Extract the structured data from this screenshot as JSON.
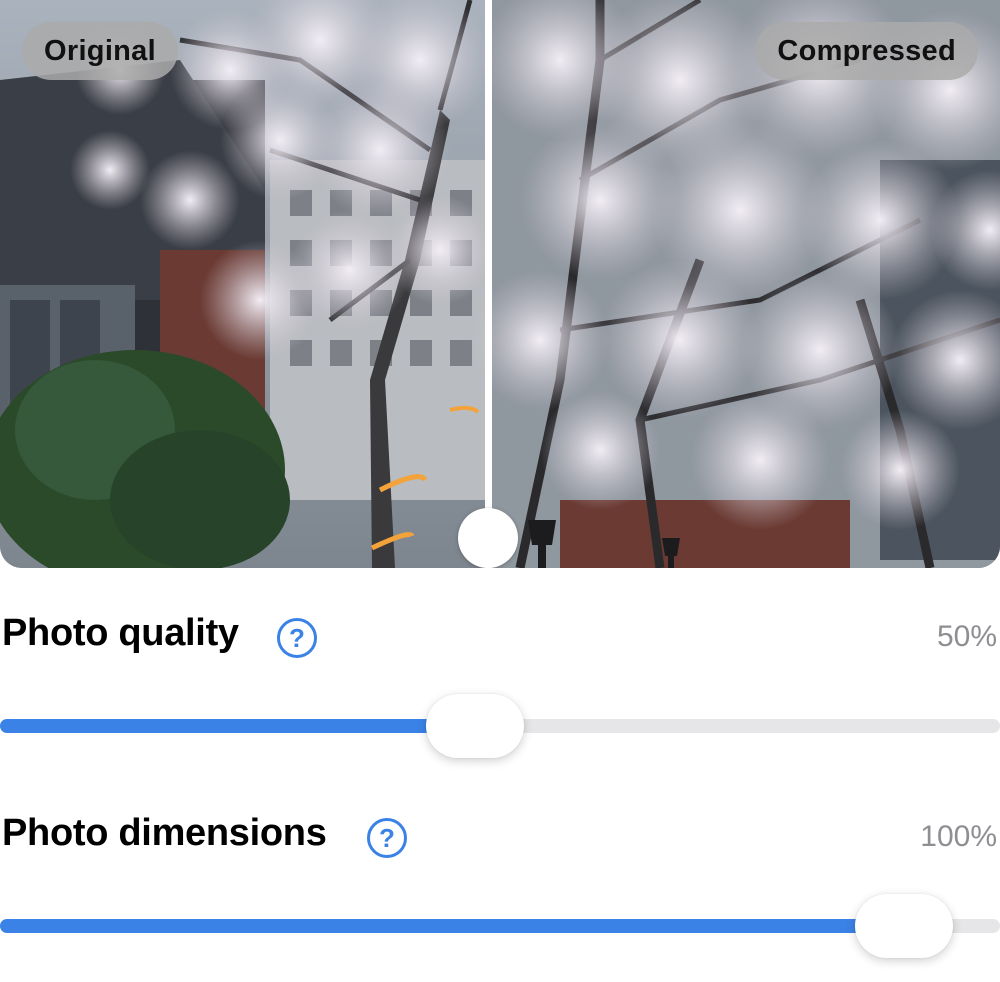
{
  "comparison": {
    "left_label": "Original",
    "right_label": "Compressed"
  },
  "settings": {
    "quality": {
      "label": "Photo quality",
      "help_icon": "question-circle-icon",
      "value_text": "50%",
      "value": 0.5
    },
    "dimensions": {
      "label": "Photo dimensions",
      "help_icon": "question-circle-icon",
      "value_text": "100%",
      "value": 1.0
    }
  },
  "colors": {
    "accent": "#3b82e6",
    "track": "#e6e6e8",
    "value_text": "#8e8e93"
  }
}
